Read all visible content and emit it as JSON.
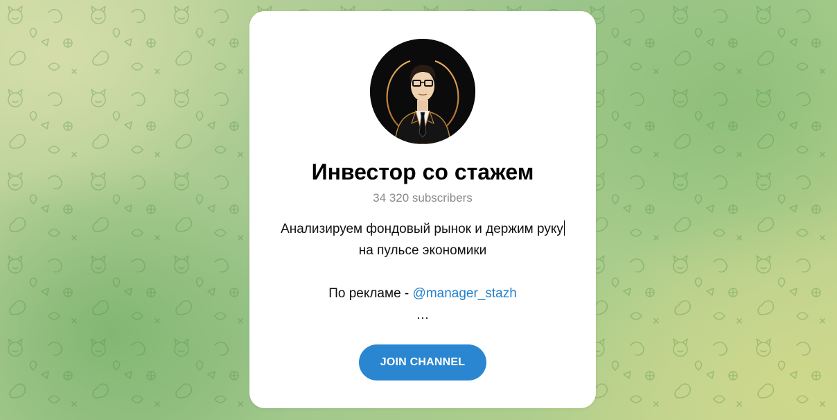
{
  "channel": {
    "title": "Инвестор со стажем",
    "subscribers": "34 320 subscribers",
    "description": {
      "line1": "Анализируем фондовый рынок и держим руку",
      "line2": "на пульсе экономики",
      "ad_prefix": "По рекламе - ",
      "ad_handle": "@manager_stazh",
      "ellipsis": "…"
    },
    "join_label": "JOIN CHANNEL",
    "avatar_icon": "businessman-avatar-icon"
  },
  "colors": {
    "accent": "#2a86d0",
    "link": "#2481cc",
    "subtitle": "#8a8a8a",
    "card": "#ffffff",
    "background": "#a9cc8c"
  }
}
